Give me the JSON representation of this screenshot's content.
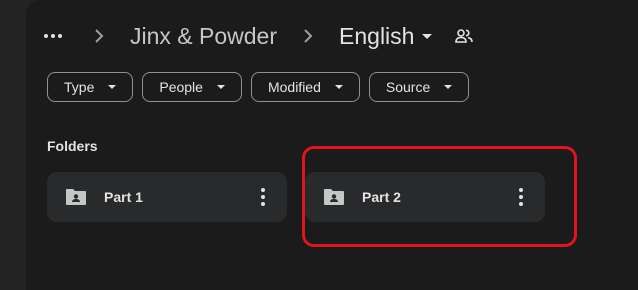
{
  "breadcrumb": {
    "more_icon": "more-horizontal-icon",
    "separator_icon": "chevron-right-icon",
    "parent_label": "Jinx & Powder",
    "current_label": "English",
    "share_icon": "people-icon"
  },
  "filters": [
    {
      "label": "Type"
    },
    {
      "label": "People"
    },
    {
      "label": "Modified"
    },
    {
      "label": "Source"
    }
  ],
  "folders_section": {
    "title": "Folders",
    "items": [
      {
        "label": "Part 1",
        "icon": "shared-folder-icon"
      },
      {
        "label": "Part 2",
        "icon": "shared-folder-icon"
      }
    ]
  },
  "colors": {
    "page_bg": "#1b1b1b",
    "card_bg": "#282a2c",
    "text": "#e3e3e3",
    "highlight": "#e0141e"
  }
}
